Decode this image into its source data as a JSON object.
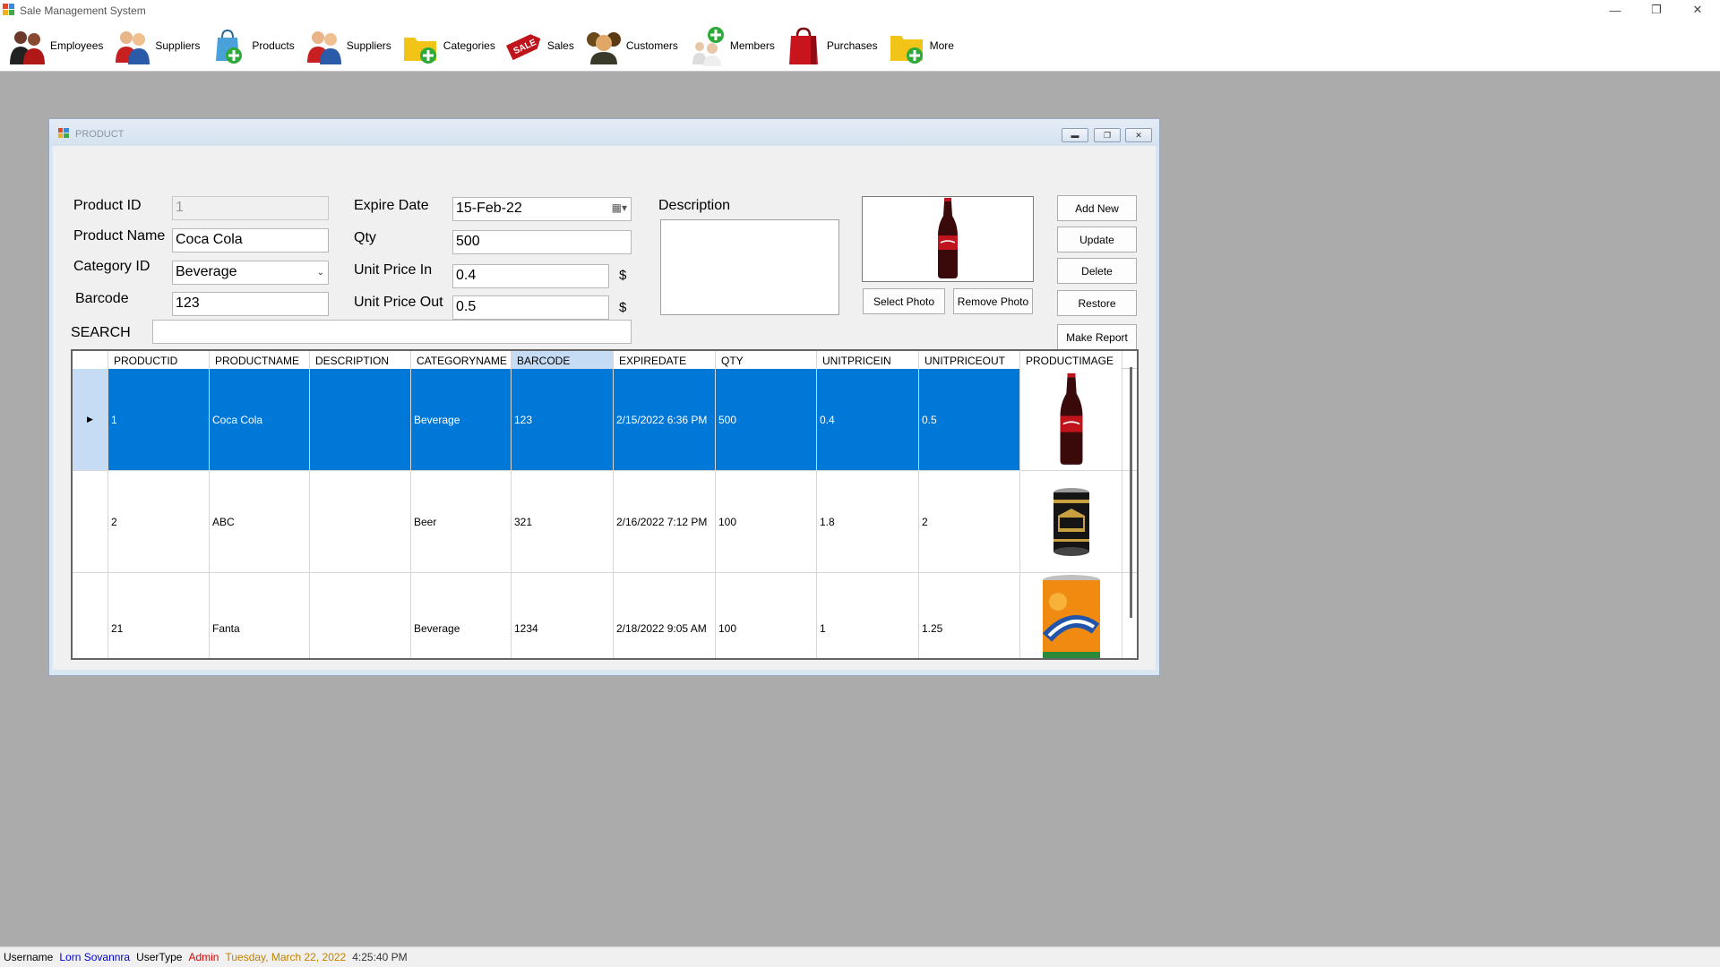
{
  "window": {
    "title": "Sale Management System"
  },
  "toolbar": {
    "items": [
      {
        "label": "Employees",
        "icon": "employees-icon"
      },
      {
        "label": "Suppliers",
        "icon": "suppliers-icon"
      },
      {
        "label": "Products",
        "icon": "products-icon"
      },
      {
        "label": "Suppliers",
        "icon": "suppliers-icon"
      },
      {
        "label": "Categories",
        "icon": "categories-icon"
      },
      {
        "label": "Sales",
        "icon": "sales-tag-icon"
      },
      {
        "label": "Customers",
        "icon": "customers-icon"
      },
      {
        "label": "Members",
        "icon": "members-icon"
      },
      {
        "label": "Purchases",
        "icon": "purchases-bag-icon"
      },
      {
        "label": "More",
        "icon": "folder-add-icon"
      }
    ]
  },
  "product_form": {
    "title": "PRODUCT",
    "labels": {
      "product_id": "Product ID",
      "product_name": "Product Name",
      "category_id": "Category ID",
      "barcode": "Barcode",
      "expire_date": "Expire Date",
      "qty": "Qty",
      "unit_price_in": "Unit Price In",
      "unit_price_out": "Unit Price Out",
      "description": "Description",
      "search": "SEARCH",
      "currency": "$"
    },
    "values": {
      "product_id": "1",
      "product_name": "Coca Cola",
      "category_id": "Beverage",
      "barcode": "123",
      "expire_date": "15-Feb-22",
      "qty": "500",
      "unit_price_in": "0.4",
      "unit_price_out": "0.5",
      "description": "",
      "search": ""
    },
    "buttons": {
      "add_new": "Add New",
      "update": "Update",
      "delete": "Delete",
      "restore": "Restore",
      "make_report": "Make Report",
      "select_photo": "Select Photo",
      "remove_photo": "Remove Photo"
    }
  },
  "grid": {
    "columns": [
      "PRODUCTID",
      "PRODUCTNAME",
      "DESCRIPTION",
      "CATEGORYNAME",
      "BARCODE",
      "EXPIREDATE",
      "QTY",
      "UNITPRICEIN",
      "UNITPRICEOUT",
      "PRODUCTIMAGE"
    ],
    "rows": [
      {
        "productid": "1",
        "productname": "Coca Cola",
        "description": "",
        "categoryname": "Beverage",
        "barcode": "123",
        "expiredate": "2/15/2022 6:36 PM",
        "qty": "500",
        "unitpricein": "0.4",
        "unitpriceout": "0.5",
        "image": "coca-cola-bottle-image"
      },
      {
        "productid": "2",
        "productname": "ABC",
        "description": "",
        "categoryname": "Beer",
        "barcode": "321",
        "expiredate": "2/16/2022 7:12 PM",
        "qty": "100",
        "unitpricein": "1.8",
        "unitpriceout": "2",
        "image": "abc-beer-can-image"
      },
      {
        "productid": "21",
        "productname": "Fanta",
        "description": "",
        "categoryname": "Beverage",
        "barcode": "1234",
        "expiredate": "2/18/2022 9:05 AM",
        "qty": "100",
        "unitpricein": "1",
        "unitpriceout": "1.25",
        "image": "fanta-can-image"
      }
    ]
  },
  "status": {
    "username_label": "Username",
    "username": "Lorn Sovannra",
    "usertype_label": "UserType",
    "usertype": "Admin",
    "date": "Tuesday, March 22, 2022",
    "time": "4:25:40 PM"
  },
  "colors": {
    "selection": "#0078d7",
    "username": "#0000cc",
    "usertype": "#e00000",
    "date": "#c08000"
  }
}
